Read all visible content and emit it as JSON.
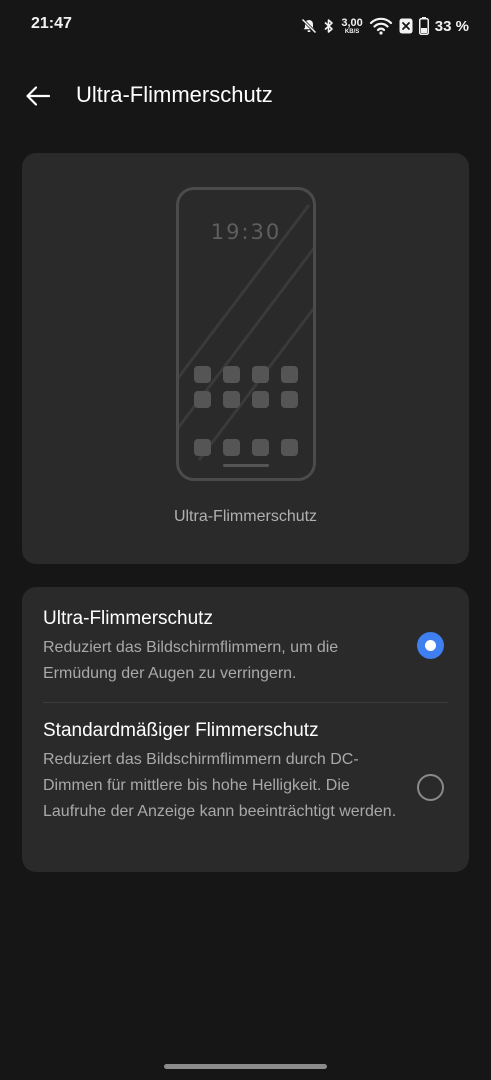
{
  "status_bar": {
    "time": "21:47",
    "net_speed_value": "3,00",
    "net_speed_unit": "KB/S",
    "battery_percent": "33 %",
    "icons": [
      "bell-off-icon",
      "bluetooth-icon",
      "wifi-icon",
      "sim-none-icon",
      "battery-icon"
    ]
  },
  "toolbar": {
    "back_icon": "arrow-left-icon",
    "title": "Ultra-Flimmerschutz"
  },
  "preview": {
    "clock": "19:30",
    "caption": "Ultra-Flimmerschutz"
  },
  "options": [
    {
      "title": "Ultra-Flimmerschutz",
      "description": "Reduziert das Bildschirmflimmern, um die Ermüdung der Augen zu verringern.",
      "selected": true
    },
    {
      "title": "Standardmäßiger Flimmerschutz",
      "description": "Reduziert das Bildschirmflimmern durch DC-Dimmen für mittlere bis hohe Helligkeit. Die Laufruhe der Anzeige kann beeinträchtigt werden.",
      "selected": false
    }
  ],
  "colors": {
    "background": "#161616",
    "card": "#2a2a2a",
    "accent": "#3f7ff0",
    "text_primary": "#ffffff",
    "text_secondary": "#a9a9a9"
  }
}
